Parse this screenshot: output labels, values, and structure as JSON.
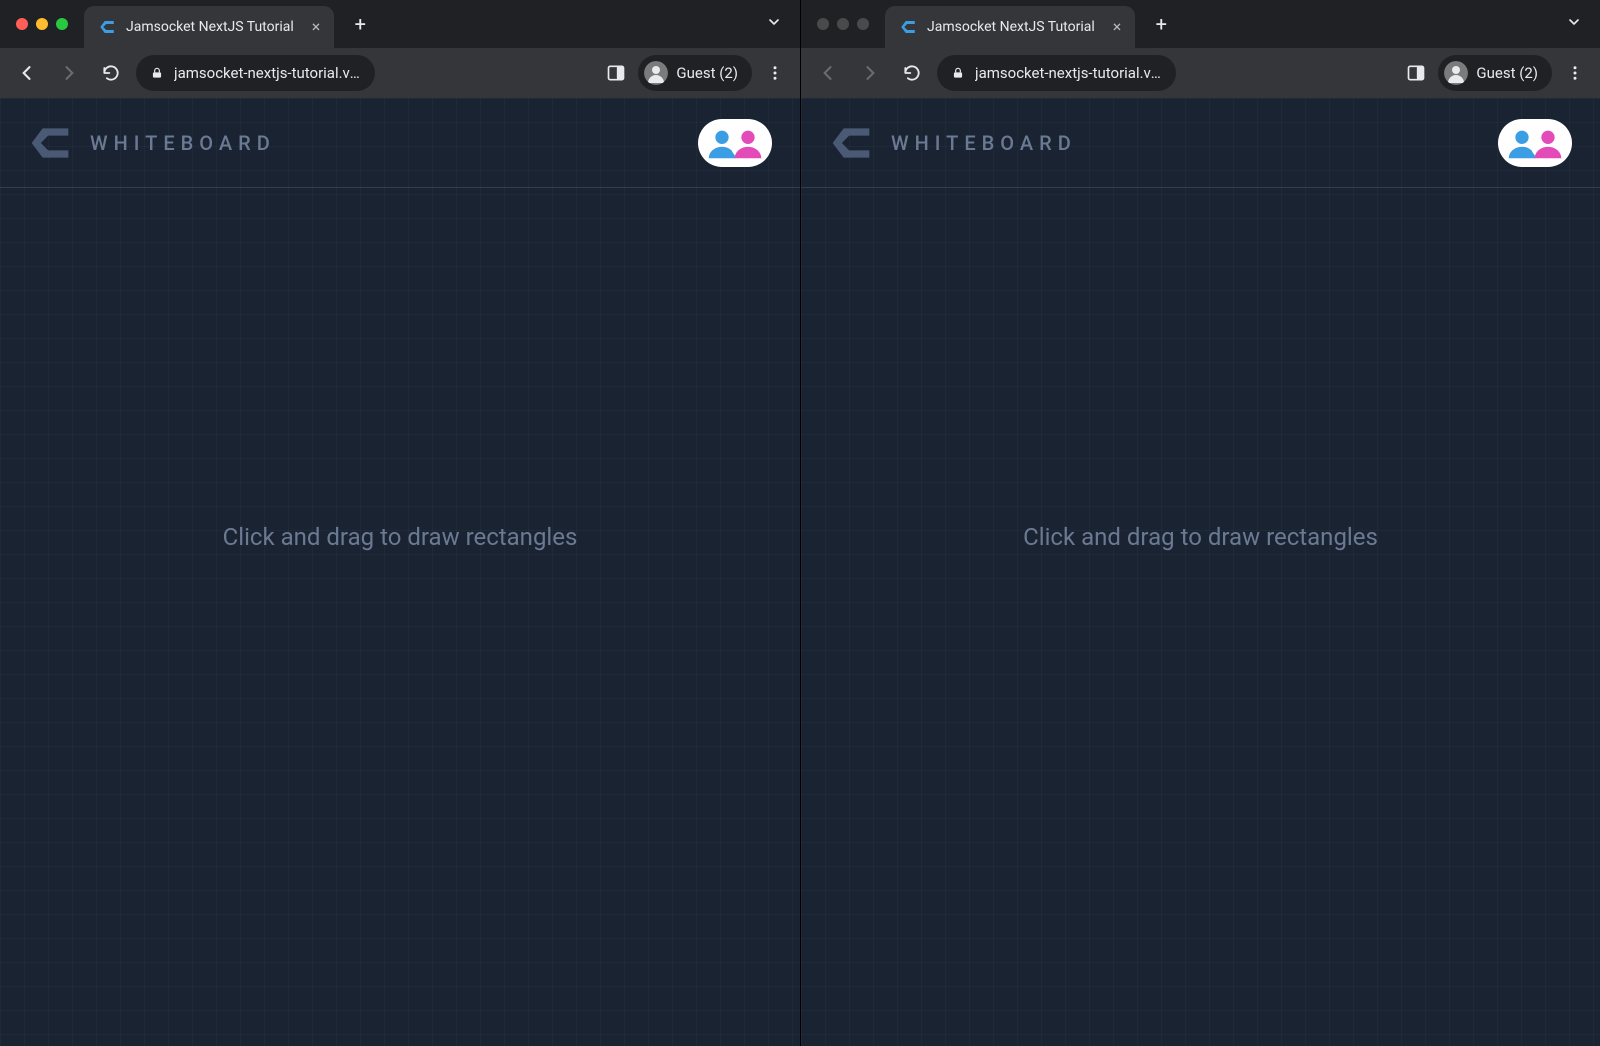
{
  "windows": [
    {
      "id": "left",
      "active": true,
      "tab": {
        "title": "Jamsocket NextJS Tutorial"
      },
      "url": "jamsocket-nextjs-tutorial.vercel...",
      "profile_label": "Guest (2)"
    },
    {
      "id": "right",
      "active": false,
      "tab": {
        "title": "Jamsocket NextJS Tutorial"
      },
      "url": "jamsocket-nextjs-tutorial.vercel...",
      "profile_label": "Guest (2)"
    }
  ],
  "app": {
    "title": "WHITEBOARD",
    "placeholder": "Click and drag to draw rectangles",
    "presence_users": [
      {
        "color": "#3b9ee5"
      },
      {
        "color": "#e34bb9"
      }
    ]
  }
}
